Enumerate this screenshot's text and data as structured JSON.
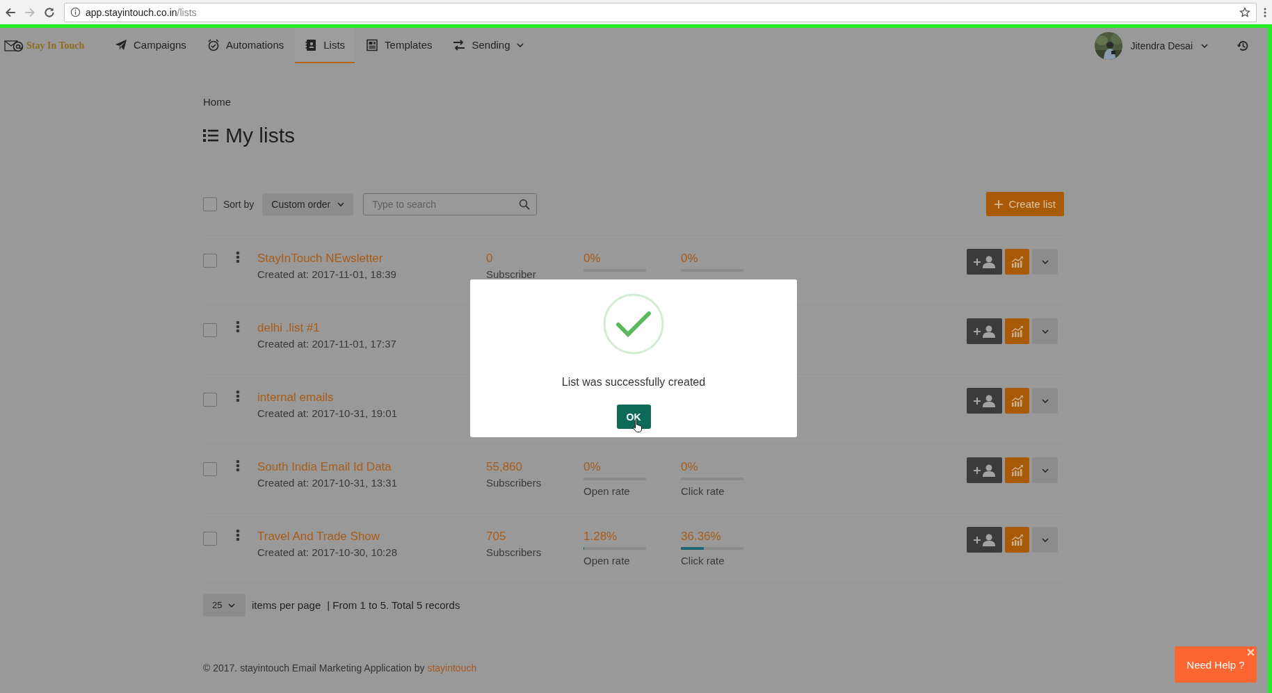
{
  "browser": {
    "url_host": "app.stayintouch.co.in",
    "url_path": "/lists"
  },
  "nav": {
    "logo": "Stay In Touch",
    "items": [
      {
        "label": "Campaigns",
        "kind": "campaigns",
        "selected": false,
        "dropdown": false
      },
      {
        "label": "Automations",
        "kind": "automations",
        "selected": false,
        "dropdown": false
      },
      {
        "label": "Lists",
        "kind": "lists",
        "selected": true,
        "dropdown": false
      },
      {
        "label": "Templates",
        "kind": "templates",
        "selected": false,
        "dropdown": false
      },
      {
        "label": "Sending",
        "kind": "sending",
        "selected": false,
        "dropdown": true
      }
    ],
    "user": {
      "name": "Jitendra Desai"
    }
  },
  "breadcrumb": "Home",
  "title": "My lists",
  "toolbar": {
    "select_all_checked": false,
    "sort_label": "Sort by",
    "sort_value": "Custom order",
    "search_placeholder": "Type to search",
    "create_button": "Create list"
  },
  "lists": [
    {
      "name": "StayInTouch NEwsletter",
      "created": "Created at: 2017-11-01, 18:39",
      "checked": false,
      "stats": {
        "count": "0",
        "count_label": "Subscriber",
        "open": {
          "value": "0%",
          "level": 0
        },
        "click": {
          "value": "0%",
          "level": 0
        }
      }
    },
    {
      "name": "delhi .list #1",
      "created": "Created at: 2017-11-01, 17:37",
      "checked": false
    },
    {
      "name": "internal emails",
      "created": "Created at: 2017-10-31, 19:01",
      "checked": false
    },
    {
      "name": "South India Email Id Data",
      "created": "Created at: 2017-10-31, 13:31",
      "checked": false,
      "stats": {
        "count": "55,860",
        "count_label": "Subscribers",
        "open": {
          "value": "0%",
          "level": 0,
          "label": "Open rate"
        },
        "click": {
          "value": "0%",
          "level": 0,
          "label": "Click rate"
        }
      }
    },
    {
      "name": "Travel And Trade Show",
      "created": "Created at: 2017-10-30, 10:28",
      "checked": false,
      "stats": {
        "count": "705",
        "count_label": "Subscribers",
        "open": {
          "value": "1.28%",
          "level": 0.0128,
          "label": "Open rate"
        },
        "click": {
          "value": "36.36%",
          "level": 0.3636,
          "label": "Click rate"
        }
      }
    }
  ],
  "pagination": {
    "per_page": "25",
    "per_page_label": "items per page",
    "summary": "| From 1 to 5. Total 5 records"
  },
  "footer": {
    "text": "© 2017. stayintouch Email Marketing Application by",
    "link": "stayintouch"
  },
  "modal": {
    "message": "List was successfully created",
    "button": "OK"
  },
  "help": {
    "label": "Need Help ?"
  }
}
